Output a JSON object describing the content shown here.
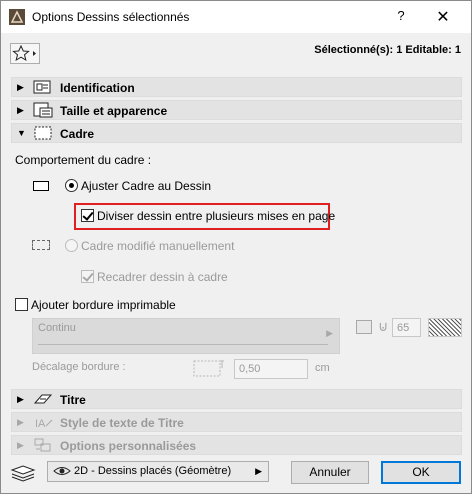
{
  "window": {
    "title": "Options Dessins sélectionnés",
    "help_label": "?",
    "close_label": "✕"
  },
  "toolbar": {
    "selection_info": "Sélectionné(s): 1 Editable: 1"
  },
  "sections": {
    "identification": "Identification",
    "size": "Taille et apparence",
    "frame": "Cadre",
    "title": "Titre",
    "title_text_style": "Style de texte de Titre",
    "custom_options": "Options personnalisées"
  },
  "frame": {
    "behavior_label": "Comportement du cadre :",
    "fit_frame_label": "Ajuster Cadre au Dessin",
    "split_label": "Diviser dessin entre plusieurs mises en page",
    "manual_label": "Cadre modifié manuellement",
    "recrop_label": "Recadrer dessin à cadre",
    "fit_frame_selected": true,
    "split_checked": true,
    "recrop_checked": true
  },
  "border": {
    "add_label": "Ajouter bordure imprimable",
    "add_checked": false,
    "line_type": "Continu",
    "pen_value": "65",
    "offset_label": "Décalage bordure :",
    "offset_value": "0,50",
    "offset_unit": "cm"
  },
  "footer": {
    "view_option": "2D - Dessins placés (Géomètre)",
    "cancel_label": "Annuler",
    "ok_label": "OK"
  },
  "colors": {
    "highlight": "#e02020",
    "ok_border": "#0078d7"
  }
}
